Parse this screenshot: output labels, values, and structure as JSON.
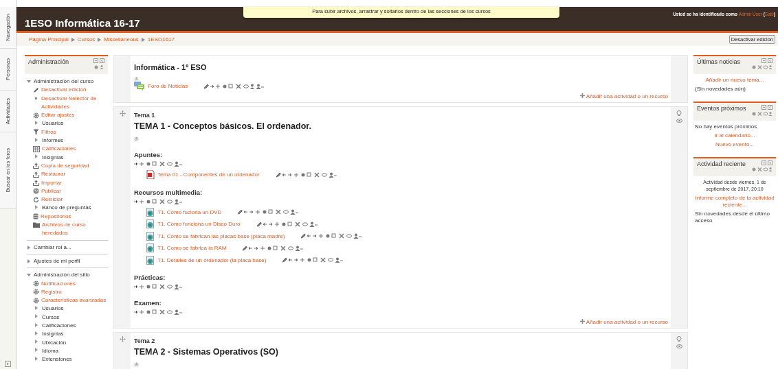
{
  "side_tabs": [
    "Navegación",
    "Personas",
    "Actividades",
    "Buscar en los foros"
  ],
  "header": {
    "title": "1ESO Informática 16-17",
    "notice": "Para subir archivos, arrastrar y soltarlos dentro de las secciones de los cursos",
    "login": [
      {
        "text": "Usted se ha identificado como ",
        "kind": "plain"
      },
      {
        "text": "Admin User",
        "kind": "link"
      },
      {
        "text": " (",
        "kind": "plain"
      },
      {
        "text": "Salir",
        "kind": "link"
      },
      {
        "text": ")",
        "kind": "plain"
      }
    ]
  },
  "breadcrumb": [
    "Página Principal",
    "Cursos",
    "Miscellaneous",
    "1ESO1617"
  ],
  "edit_button": "Desactivar edición",
  "admin_block": {
    "title": "Administración",
    "items": [
      {
        "text": "Administración del curso",
        "kind": "branch",
        "expanded": true,
        "children": [
          {
            "text": "Desactivar edición",
            "kind": "pencil"
          },
          {
            "text": "Desactivar Selector de Actividades",
            "kind": "bullet"
          },
          {
            "text": "Editar ajustes",
            "kind": "gear"
          },
          {
            "text": "Usuarios",
            "kind": "branch",
            "expanded": false
          },
          {
            "text": "Filtros",
            "kind": "filter"
          },
          {
            "text": "Informes",
            "kind": "branch",
            "expanded": false
          },
          {
            "text": "Calificaciones",
            "kind": "table"
          },
          {
            "text": "Insignias",
            "kind": "branch",
            "expanded": false
          },
          {
            "text": "Copia de seguridad",
            "kind": "upload"
          },
          {
            "text": "Restaurar",
            "kind": "upload"
          },
          {
            "text": "Importar",
            "kind": "upload"
          },
          {
            "text": "Publicar",
            "kind": "globe"
          },
          {
            "text": "Reiniciar",
            "kind": "refresh"
          },
          {
            "text": "Banco de preguntas",
            "kind": "branch",
            "expanded": false
          },
          {
            "text": "Repositorios",
            "kind": "database"
          },
          {
            "text": "Archivos de curso heredados",
            "kind": "folder"
          }
        ]
      },
      {
        "text": "Cambiar rol a...",
        "kind": "branch",
        "expanded": false
      },
      {
        "text": "Ajustes de mi perfil",
        "kind": "branch",
        "expanded": false
      },
      {
        "text": "Administración del sitio",
        "kind": "branch",
        "expanded": true,
        "children": [
          {
            "text": "Notificaciones",
            "kind": "gear"
          },
          {
            "text": "Registro",
            "kind": "gear"
          },
          {
            "text": "Características avanzadas",
            "kind": "gear"
          },
          {
            "text": "Usuarios",
            "kind": "branch",
            "expanded": false
          },
          {
            "text": "Cursos",
            "kind": "branch",
            "expanded": false
          },
          {
            "text": "Calificaciones",
            "kind": "branch",
            "expanded": false
          },
          {
            "text": "Insignias",
            "kind": "branch",
            "expanded": false
          },
          {
            "text": "Ubicación",
            "kind": "branch",
            "expanded": false
          },
          {
            "text": "Idioma",
            "kind": "branch",
            "expanded": false
          },
          {
            "text": "Extensiones",
            "kind": "branch",
            "expanded": false
          }
        ]
      }
    ]
  },
  "sections": [
    {
      "title": "Informática - 1º ESO",
      "activities": [
        {
          "kind": "forum",
          "name": "Foro de Noticias"
        }
      ],
      "add_link": "Añadir una actividad o un recurso"
    },
    {
      "label": "Tema 1",
      "title": "TEMA 1 - Conceptos básicos. El ordenador.",
      "groups": [
        {
          "heading": "Apuntes:",
          "activities": [
            {
              "kind": "pdf",
              "name": "Tema 01 - Componentes de un ordenador"
            }
          ]
        },
        {
          "heading": "Recursos multimedia:",
          "activities": [
            {
              "kind": "media",
              "name": "T1. Cómo fuciona un DVD"
            },
            {
              "kind": "media",
              "name": "T1. Cómo funciona un Disco Duro"
            },
            {
              "kind": "media",
              "name": "T1. Cómo se fabrican las placas base (placa madre)"
            },
            {
              "kind": "media",
              "name": "T1. Como se fabrica la RAM"
            },
            {
              "kind": "media",
              "name": "T1. Detalles de un ordenador (la placa base)"
            }
          ]
        },
        {
          "heading": "Prácticas:"
        },
        {
          "heading": "Examen:"
        }
      ],
      "add_link": "Añadir una actividad o un recurso"
    },
    {
      "label": "Tema 2",
      "title": "TEMA 2 - Sistemas Operativos (SO)"
    }
  ],
  "right_blocks": [
    {
      "title": "Últimas noticias",
      "lines": [
        {
          "text": "Añadir un nuevo tema...",
          "kind": "link"
        },
        {
          "text": "(Sin novedades aún)",
          "kind": "plain"
        }
      ]
    },
    {
      "title": "Eventos próximos",
      "lines": [
        {
          "text": "No hay eventos próximos",
          "kind": "plain"
        },
        {
          "text": "Ir al calendario...",
          "kind": "link"
        },
        {
          "text": "Nuevo evento...",
          "kind": "link"
        }
      ]
    },
    {
      "title": "Actividad reciente",
      "lines": [
        {
          "text": "Actividad desde viernes, 1 de septiembre de 2017, 20:10",
          "kind": "note"
        },
        {
          "text": "Informe completo de la actividad reciente...",
          "kind": "link"
        },
        {
          "text": "Sin novedades desde el último acceso",
          "kind": "plain"
        }
      ]
    }
  ]
}
